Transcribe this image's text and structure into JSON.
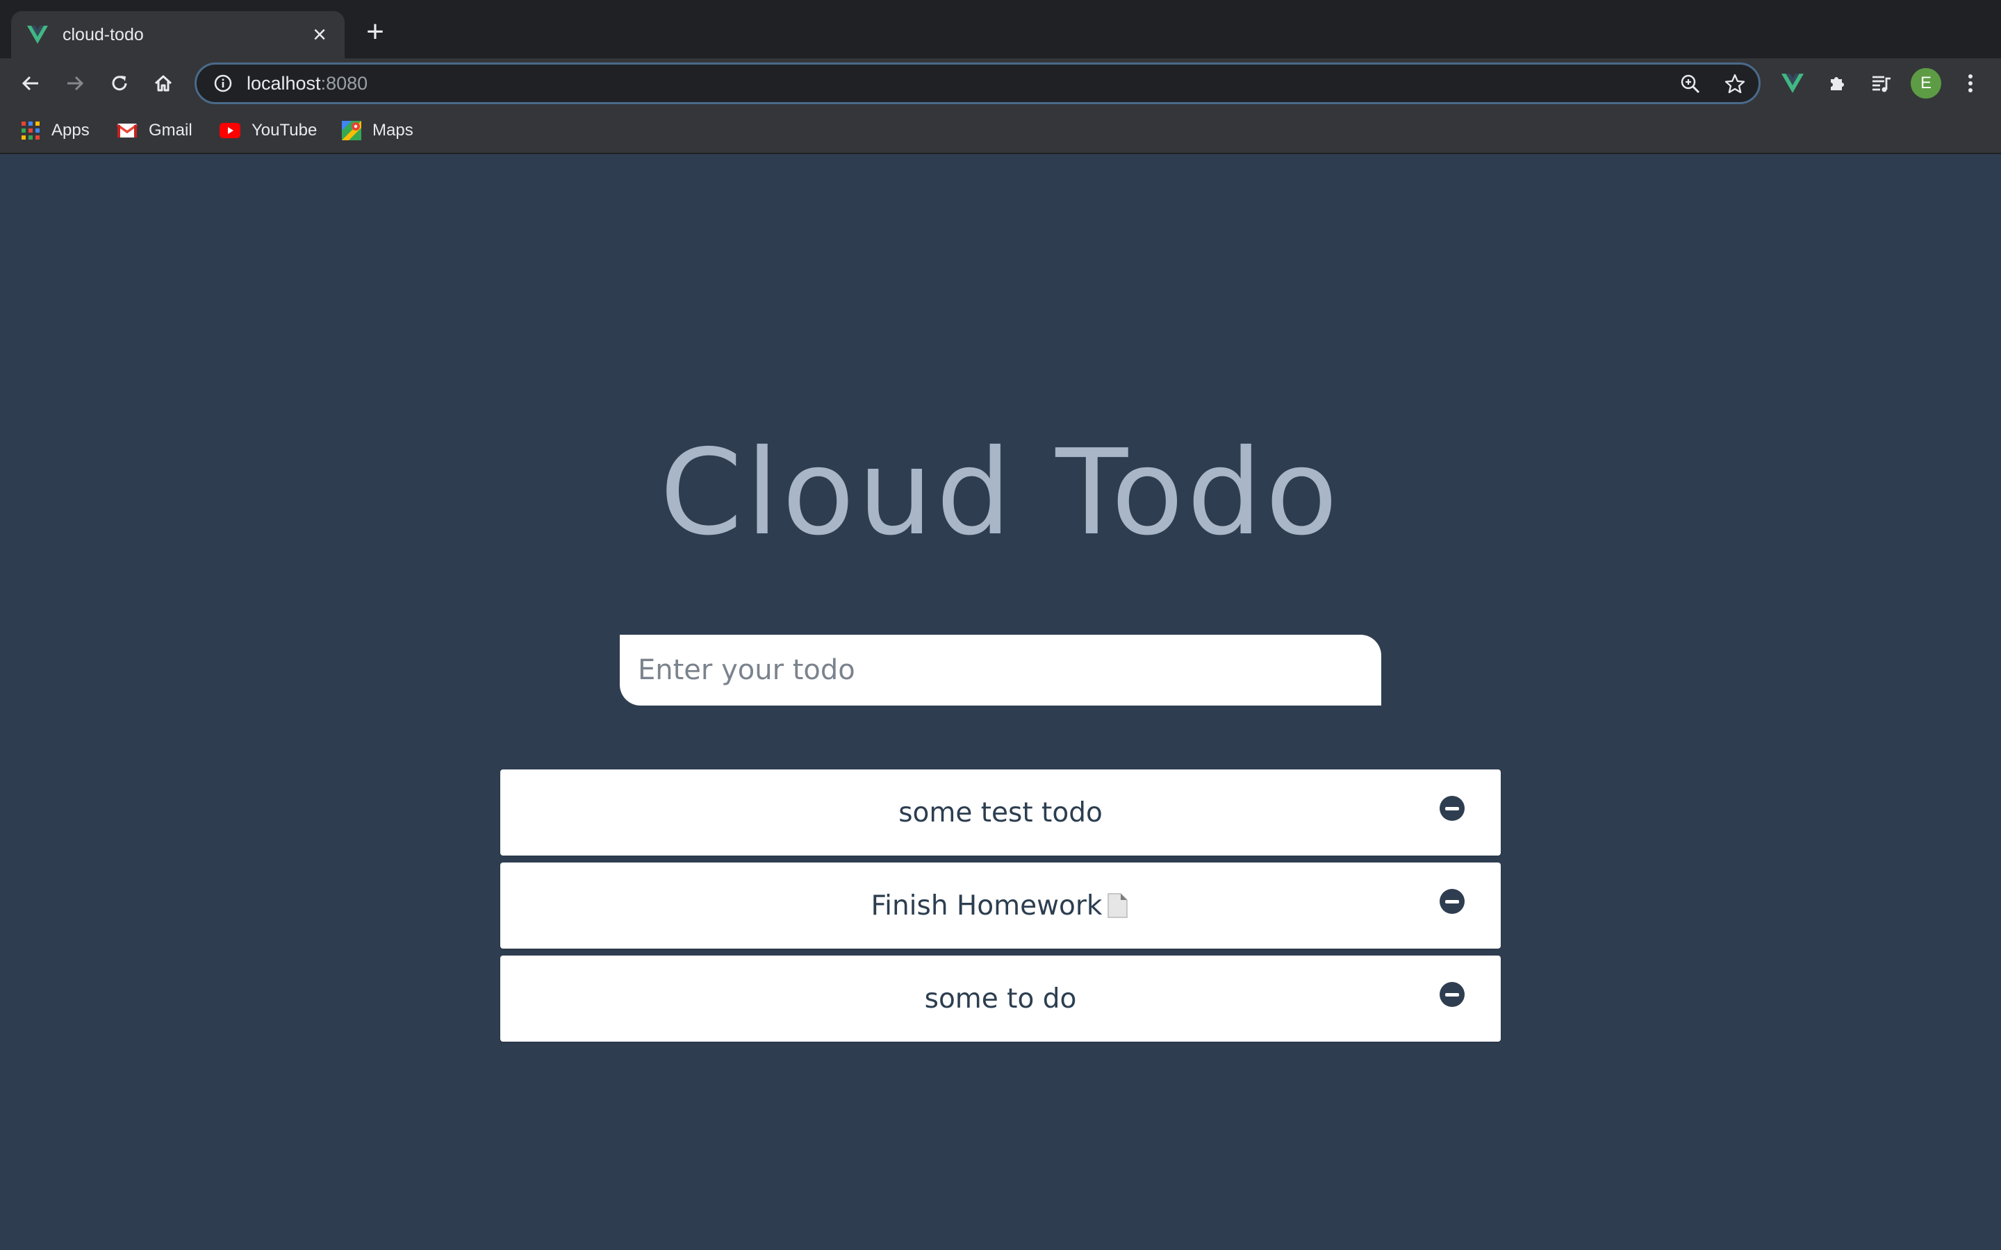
{
  "browser": {
    "tab": {
      "title": "cloud-todo",
      "favicon": "vue-logo-icon"
    },
    "new_tab_label": "+",
    "address": {
      "host": "localhost",
      "port": ":8080"
    },
    "bookmarks": [
      {
        "label": "Apps",
        "icon": "apps-grid-icon"
      },
      {
        "label": "Gmail",
        "icon": "gmail-icon"
      },
      {
        "label": "YouTube",
        "icon": "youtube-icon"
      },
      {
        "label": "Maps",
        "icon": "maps-icon"
      }
    ],
    "profile_initial": "E",
    "colors": {
      "vue_green": "#41b883",
      "avatar": "#5d9c44"
    }
  },
  "app": {
    "title": "Cloud Todo",
    "input": {
      "placeholder": "Enter your todo",
      "value": ""
    },
    "todos": [
      {
        "text": "some test todo",
        "has_doc_icon": false
      },
      {
        "text": "Finish Homework",
        "has_doc_icon": true
      },
      {
        "text": "some to do",
        "has_doc_icon": false
      }
    ],
    "colors": {
      "background": "#2f3d50",
      "title": "#a9b6c8",
      "item_text": "#2c3e50"
    }
  }
}
